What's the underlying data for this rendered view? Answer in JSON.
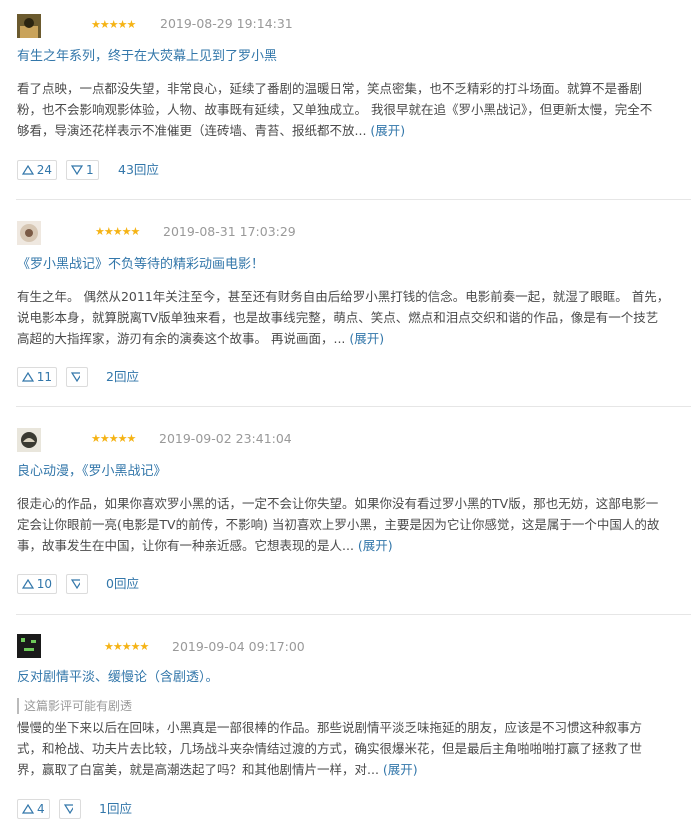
{
  "reviews": [
    {
      "date": "2019-08-29 19:14:31",
      "title": "有生之年系列，终于在大荧幕上见到了罗小黑",
      "lines": [
        "看了点映，一点都没失望，非常良心，延续了番剧的温暖日常，笑点密集，也不乏精彩的打斗场面。就算不是番剧",
        "粉，也不会影响观影体验，人物、故事既有延续，又单独成立。 我很早就在追《罗小黑战记》，但更新太慢，完全不",
        "够看，导演还花样表示不准催更（连砖墙、青苔、报纸都不放..."
      ],
      "expand": "(展开)",
      "up": "24",
      "down": "1",
      "replies": "43回应",
      "avatar_icon": "avatar-icon",
      "rating_glyph": "★★★★★"
    },
    {
      "date": "2019-08-31 17:03:29",
      "title": "《罗小黑战记》不负等待的精彩动画电影！",
      "lines": [
        "有生之年。 偶然从2011年关注至今，甚至还有财务自由后给罗小黑打钱的信念。电影前奏一起，就湿了眼眶。 首先，",
        "说电影本身，就算脱离TV版单独来看，也是故事线完整，萌点、笑点、燃点和泪点交织和谐的作品，像是有一个技艺",
        "高超的大指挥家，游刃有余的演奏这个故事。 再说画面，..."
      ],
      "expand": "(展开)",
      "up": "11",
      "down": "",
      "replies": "2回应",
      "avatar_icon": "avatar-icon",
      "rating_glyph": "★★★★★"
    },
    {
      "date": "2019-09-02 23:41:04",
      "title": "良心动漫，《罗小黑战记》",
      "lines": [
        "很走心的作品，如果你喜欢罗小黑的话，一定不会让你失望。如果你没有看过罗小黑的TV版，那也无妨，这部电影一",
        "定会让你眼前一亮(电影是TV的前传，不影响) 当初喜欢上罗小黑，主要是因为它让你感觉，这是属于一个中国人的故",
        "事，故事发生在中国，让你有一种亲近感。它想表现的是人..."
      ],
      "expand": "(展开)",
      "up": "10",
      "down": "",
      "replies": "0回应",
      "avatar_icon": "avatar-icon",
      "rating_glyph": "★★★★★"
    },
    {
      "date": "2019-09-04 09:17:00",
      "title": "反对剧情平淡、缓慢论（含剧透）。",
      "spoiler": "这篇影评可能有剧透",
      "lines": [
        "慢慢的坐下来以后在回味，小黑真是一部很棒的作品。那些说剧情平淡乏味拖延的朋友，应该是不习惯这种叙事方",
        "式，和枪战、功夫片去比较，几场战斗夹杂情结过渡的方式，确实很爆米花，但是最后主角啪啪啪打赢了拯救了世",
        "界，赢取了白富美，就是高潮迭起了吗？和其他剧情片一样，对..."
      ],
      "expand": "(展开)",
      "up": "4",
      "down": "",
      "replies": "1回应",
      "avatar_icon": "avatar-icon",
      "rating_glyph": "★★★★★"
    }
  ],
  "colors": {
    "link": "#3377aa",
    "star": "#f5b315",
    "meta": "#999999",
    "body": "#4a4a4a"
  }
}
